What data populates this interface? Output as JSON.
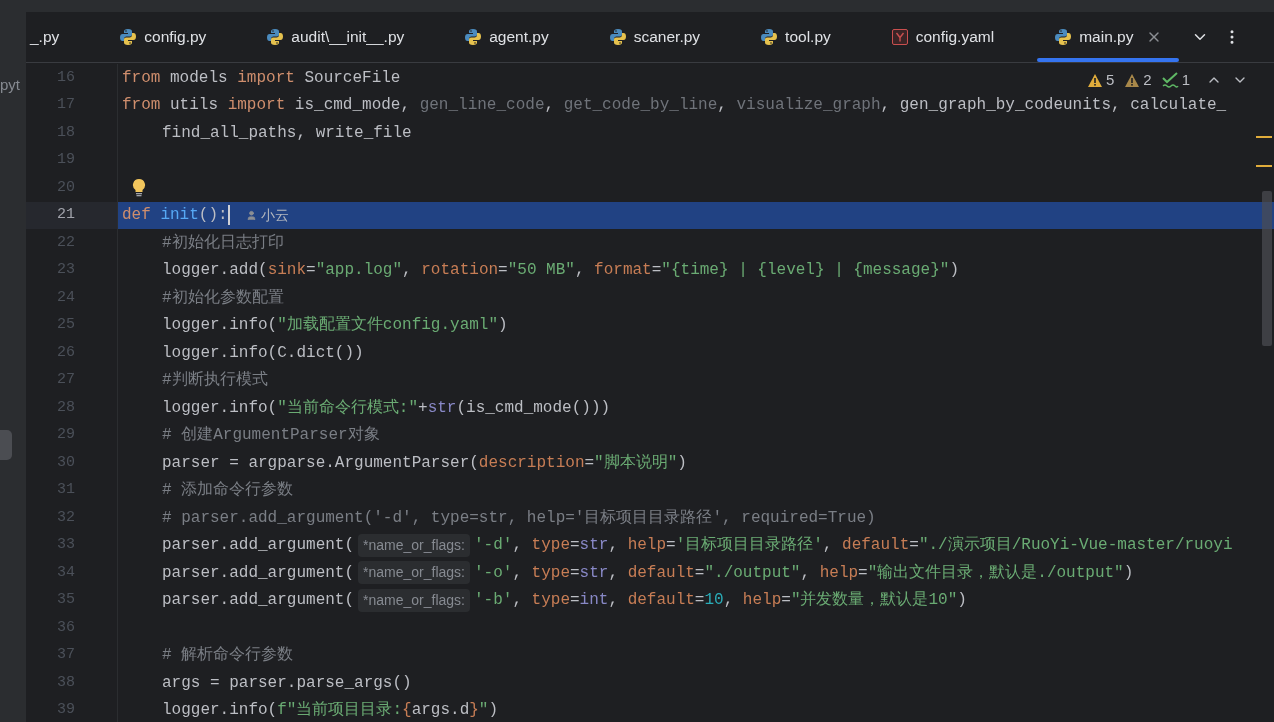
{
  "tabs": [
    {
      "label": "_.py",
      "kind": "none",
      "selected": false
    },
    {
      "label": "config.py",
      "kind": "python",
      "selected": false
    },
    {
      "label": "audit\\__init__.py",
      "kind": "python",
      "selected": false
    },
    {
      "label": "agent.py",
      "kind": "python",
      "selected": false
    },
    {
      "label": "scaner.py",
      "kind": "python",
      "selected": false
    },
    {
      "label": "tool.py",
      "kind": "python",
      "selected": false
    },
    {
      "label": "config.yaml",
      "kind": "yaml",
      "selected": false
    },
    {
      "label": "main.py",
      "kind": "python",
      "selected": true
    }
  ],
  "side_panel": {
    "label": "pyt"
  },
  "inspections": [
    {
      "kind": "warning",
      "count": "5"
    },
    {
      "kind": "weak",
      "count": "2"
    },
    {
      "kind": "ok",
      "count": "1"
    }
  ],
  "lines": [
    {
      "number": "16",
      "selected": false,
      "bulb": false,
      "indented": false,
      "tokens": [
        {
          "kind": "keyword",
          "text": "from"
        },
        {
          "kind": "text",
          "text": " models "
        },
        {
          "kind": "keyword",
          "text": "import"
        },
        {
          "kind": "text",
          "text": " SourceFile"
        }
      ]
    },
    {
      "number": "17",
      "selected": false,
      "bulb": false,
      "indented": false,
      "tokens": [
        {
          "kind": "keyword",
          "text": "from"
        },
        {
          "kind": "text",
          "text": " utils "
        },
        {
          "kind": "keyword",
          "text": "import"
        },
        {
          "kind": "text",
          "text": " is_cmd_mode, "
        },
        {
          "kind": "dim",
          "text": "gen_line_code"
        },
        {
          "kind": "text",
          "text": ", "
        },
        {
          "kind": "dim",
          "text": "get_code_by_line"
        },
        {
          "kind": "text",
          "text": ", "
        },
        {
          "kind": "dim",
          "text": "visualize_graph"
        },
        {
          "kind": "text",
          "text": ", gen_graph_by_codeunits, calculate_"
        }
      ]
    },
    {
      "number": "18",
      "selected": false,
      "bulb": false,
      "indented": true,
      "tokens": [
        {
          "kind": "text",
          "text": "find_all_paths, write_file"
        }
      ]
    },
    {
      "number": "19",
      "selected": false,
      "bulb": false
    },
    {
      "number": "20",
      "selected": false,
      "bulb": true,
      "indented": false
    },
    {
      "number": "21",
      "selected": true,
      "bulb": false,
      "indented": false,
      "tokens": [
        {
          "kind": "keyword",
          "text": "def "
        },
        {
          "kind": "function",
          "text": "init"
        },
        {
          "kind": "text",
          "text": "():"
        },
        {
          "kind": "caret"
        },
        {
          "kind": "author",
          "text": "小云"
        }
      ]
    },
    {
      "number": "22",
      "selected": false,
      "bulb": false,
      "indented": true,
      "tokens": [
        {
          "kind": "comment",
          "text": "#初始化日志打印"
        }
      ]
    },
    {
      "number": "23",
      "selected": false,
      "bulb": false,
      "indented": true,
      "tokens": [
        {
          "kind": "text",
          "text": "logger.add("
        },
        {
          "kind": "param",
          "text": "sink"
        },
        {
          "kind": "text",
          "text": "="
        },
        {
          "kind": "string",
          "text": "\"app.log\""
        },
        {
          "kind": "text",
          "text": ", "
        },
        {
          "kind": "param",
          "text": "rotation"
        },
        {
          "kind": "text",
          "text": "="
        },
        {
          "kind": "string",
          "text": "\"50 MB\""
        },
        {
          "kind": "text",
          "text": ", "
        },
        {
          "kind": "param",
          "text": "format"
        },
        {
          "kind": "text",
          "text": "="
        },
        {
          "kind": "string",
          "text": "\"{time} | {level} | {message}\""
        },
        {
          "kind": "text",
          "text": ")"
        }
      ]
    },
    {
      "number": "24",
      "selected": false,
      "bulb": false,
      "indented": true,
      "tokens": [
        {
          "kind": "comment",
          "text": "#初始化参数配置"
        }
      ]
    },
    {
      "number": "25",
      "selected": false,
      "bulb": false,
      "indented": true,
      "tokens": [
        {
          "kind": "text",
          "text": "logger.info("
        },
        {
          "kind": "string",
          "text": "\"加载配置文件config.yaml\""
        },
        {
          "kind": "text",
          "text": ")"
        }
      ]
    },
    {
      "number": "26",
      "selected": false,
      "bulb": false,
      "indented": true,
      "tokens": [
        {
          "kind": "text",
          "text": "logger.info(C.dict())"
        }
      ]
    },
    {
      "number": "27",
      "selected": false,
      "bulb": false,
      "indented": true,
      "tokens": [
        {
          "kind": "comment",
          "text": "#判断执行模式"
        }
      ]
    },
    {
      "number": "28",
      "selected": false,
      "bulb": false,
      "indented": true,
      "tokens": [
        {
          "kind": "text",
          "text": "logger.info("
        },
        {
          "kind": "string",
          "text": "\"当前命令行模式:\""
        },
        {
          "kind": "text",
          "text": "+"
        },
        {
          "kind": "builtin",
          "text": "str"
        },
        {
          "kind": "text",
          "text": "(is_cmd_mode()))"
        }
      ]
    },
    {
      "number": "29",
      "selected": false,
      "bulb": false,
      "indented": true,
      "tokens": [
        {
          "kind": "comment",
          "text": "# 创建ArgumentParser对象"
        }
      ]
    },
    {
      "number": "30",
      "selected": false,
      "bulb": false,
      "indented": true,
      "tokens": [
        {
          "kind": "text",
          "text": "parser = argparse.ArgumentParser("
        },
        {
          "kind": "param",
          "text": "description"
        },
        {
          "kind": "text",
          "text": "="
        },
        {
          "kind": "string",
          "text": "\"脚本说明\""
        },
        {
          "kind": "text",
          "text": ")"
        }
      ]
    },
    {
      "number": "31",
      "selected": false,
      "bulb": false,
      "indented": true,
      "tokens": [
        {
          "kind": "comment",
          "text": "# 添加命令行参数"
        }
      ]
    },
    {
      "number": "32",
      "selected": false,
      "bulb": false,
      "indented": true,
      "tokens": [
        {
          "kind": "comment",
          "text": "# parser.add_argument('-d', type=str, help='目标项目目录路径', required=True)"
        }
      ]
    },
    {
      "number": "33",
      "selected": false,
      "bulb": false,
      "indented": true,
      "tokens": [
        {
          "kind": "text",
          "text": "parser.add_argument("
        },
        {
          "kind": "hint",
          "text": "*name_or_flags:"
        },
        {
          "kind": "string",
          "text": "'-d'"
        },
        {
          "kind": "text",
          "text": ", "
        },
        {
          "kind": "param",
          "text": "type"
        },
        {
          "kind": "text",
          "text": "="
        },
        {
          "kind": "builtin",
          "text": "str"
        },
        {
          "kind": "text",
          "text": ", "
        },
        {
          "kind": "param",
          "text": "help"
        },
        {
          "kind": "text",
          "text": "="
        },
        {
          "kind": "string",
          "text": "'目标项目目录路径'"
        },
        {
          "kind": "text",
          "text": ", "
        },
        {
          "kind": "param",
          "text": "default"
        },
        {
          "kind": "text",
          "text": "="
        },
        {
          "kind": "string",
          "text": "\"./演示项目/RuoYi-Vue-master/ruoyi"
        }
      ]
    },
    {
      "number": "34",
      "selected": false,
      "bulb": false,
      "indented": true,
      "tokens": [
        {
          "kind": "text",
          "text": "parser.add_argument("
        },
        {
          "kind": "hint",
          "text": "*name_or_flags:"
        },
        {
          "kind": "string",
          "text": "'-o'"
        },
        {
          "kind": "text",
          "text": ", "
        },
        {
          "kind": "param",
          "text": "type"
        },
        {
          "kind": "text",
          "text": "="
        },
        {
          "kind": "builtin",
          "text": "str"
        },
        {
          "kind": "text",
          "text": ", "
        },
        {
          "kind": "param",
          "text": "default"
        },
        {
          "kind": "text",
          "text": "="
        },
        {
          "kind": "string",
          "text": "\"./output\""
        },
        {
          "kind": "text",
          "text": ", "
        },
        {
          "kind": "param",
          "text": "help"
        },
        {
          "kind": "text",
          "text": "="
        },
        {
          "kind": "string",
          "text": "\"输出文件目录，默认是./output\""
        },
        {
          "kind": "text",
          "text": ")"
        }
      ]
    },
    {
      "number": "35",
      "selected": false,
      "bulb": false,
      "indented": true,
      "tokens": [
        {
          "kind": "text",
          "text": "parser.add_argument("
        },
        {
          "kind": "hint",
          "text": "*name_or_flags:"
        },
        {
          "kind": "string",
          "text": "'-b'"
        },
        {
          "kind": "text",
          "text": ", "
        },
        {
          "kind": "param",
          "text": "type"
        },
        {
          "kind": "text",
          "text": "="
        },
        {
          "kind": "builtin",
          "text": "int"
        },
        {
          "kind": "text",
          "text": ", "
        },
        {
          "kind": "param",
          "text": "default"
        },
        {
          "kind": "text",
          "text": "="
        },
        {
          "kind": "number",
          "text": "10"
        },
        {
          "kind": "text",
          "text": ", "
        },
        {
          "kind": "param",
          "text": "help"
        },
        {
          "kind": "text",
          "text": "="
        },
        {
          "kind": "string",
          "text": "\"并发数量，默认是10\""
        },
        {
          "kind": "text",
          "text": ")"
        }
      ]
    },
    {
      "number": "36",
      "selected": false,
      "bulb": false
    },
    {
      "number": "37",
      "selected": false,
      "bulb": false,
      "indented": true,
      "tokens": [
        {
          "kind": "comment",
          "text": "# 解析命令行参数"
        }
      ]
    },
    {
      "number": "38",
      "selected": false,
      "bulb": false,
      "indented": true,
      "tokens": [
        {
          "kind": "text",
          "text": "args = parser.parse_args()"
        }
      ]
    },
    {
      "number": "39",
      "selected": false,
      "bulb": false,
      "indented": true,
      "tokens": [
        {
          "kind": "text",
          "text": "logger.info("
        },
        {
          "kind": "string",
          "text": "f\"当前项目目录:"
        },
        {
          "kind": "param",
          "text": "{"
        },
        {
          "kind": "text",
          "text": "args.d"
        },
        {
          "kind": "param",
          "text": "}"
        },
        {
          "kind": "string",
          "text": "\""
        },
        {
          "kind": "text",
          "text": ")"
        }
      ]
    }
  ]
}
